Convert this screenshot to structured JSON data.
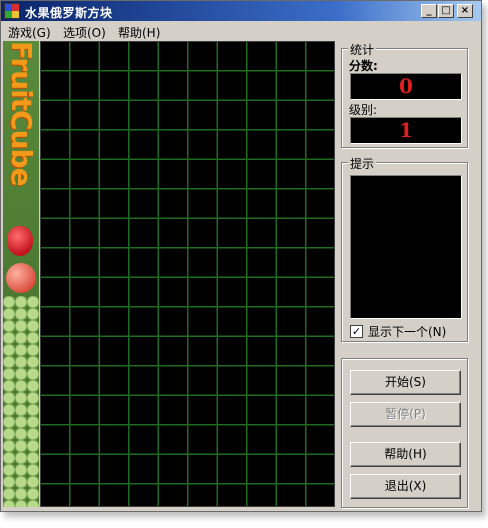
{
  "window": {
    "title": "水果俄罗斯方块"
  },
  "title_buttons": {
    "minimize": "_",
    "maximize": "□",
    "close": "×"
  },
  "menu": [
    {
      "label": "游戏(G)"
    },
    {
      "label": "选项(O)"
    },
    {
      "label": "帮助(H)"
    }
  ],
  "banner": {
    "logo": "FruitCube"
  },
  "stats": {
    "title": "统计",
    "score_label": "分数:",
    "score_value": "0",
    "level_label": "级别:",
    "level_value": "1"
  },
  "hint": {
    "title": "提示",
    "show_next_label": "显示下一个(N)",
    "show_next_checked": true
  },
  "buttons": {
    "start": "开始(S)",
    "pause": "暂停(P)",
    "help": "帮助(H)",
    "exit": "退出(X)"
  }
}
